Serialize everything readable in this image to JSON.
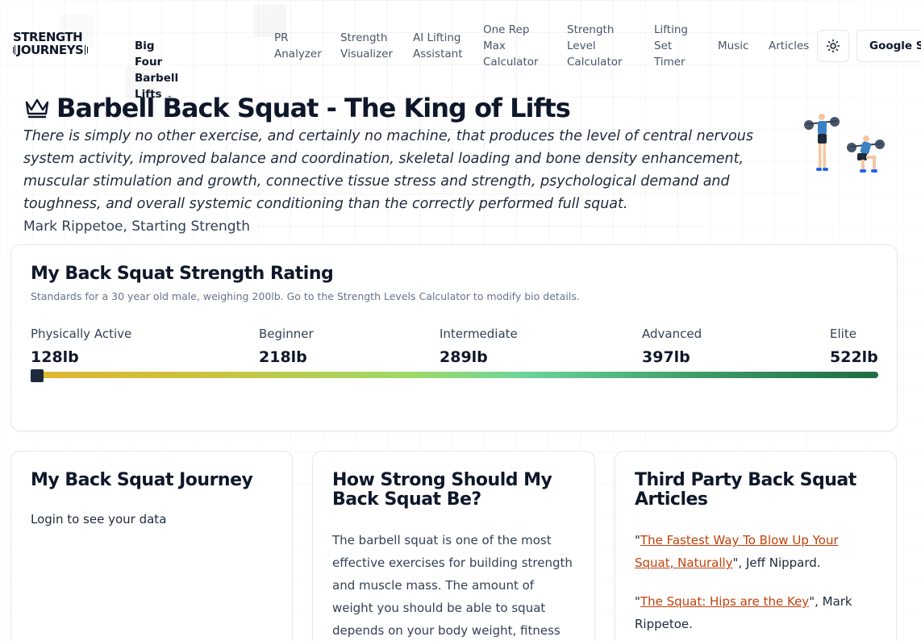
{
  "header": {
    "logo_line1": "STRENGTH",
    "logo_line2": "JOURNEYS",
    "nav": [
      {
        "label": "Big Four Barbell Lifts",
        "has_dropdown": true
      },
      {
        "label": "PR Analyzer"
      },
      {
        "label": "Strength Visualizer"
      },
      {
        "label": "AI Lifting Assistant"
      },
      {
        "label": "One Rep Max Calculator"
      },
      {
        "label": "Strength Level Calculator"
      },
      {
        "label": "Lifting Set Timer"
      },
      {
        "label": "Music"
      },
      {
        "label": "Articles"
      }
    ],
    "theme_icon": "sun-icon",
    "google_label": "Google Sign in"
  },
  "hero": {
    "title": "Barbell Back Squat - The King of Lifts",
    "quote": "There is simply no other exercise, and certainly no machine, that produces the level of central nervous system activity, improved balance and coordination, skeletal loading and bone density enhancement, muscular stimulation and growth, connective tissue stress and strength, psychological demand and toughness, and overall systemic conditioning than the correctly performed full squat.",
    "attribution": "Mark Rippetoe, Starting Strength"
  },
  "rating": {
    "title": "My Back Squat Strength Rating",
    "subtitle": "Standards for a 30 year old male, weighing 200lb. Go to the Strength Levels Calculator to modify bio details.",
    "levels": [
      {
        "name": "Physically Active",
        "value": "128lb"
      },
      {
        "name": "Beginner",
        "value": "218lb"
      },
      {
        "name": "Intermediate",
        "value": "289lb"
      },
      {
        "name": "Advanced",
        "value": "397lb"
      },
      {
        "name": "Elite",
        "value": "522lb"
      }
    ],
    "progress": 0
  },
  "journey": {
    "title": "My Back Squat Journey",
    "text": "Login to see your data"
  },
  "howstrong": {
    "title": "How Strong Should My Back Squat Be?",
    "text": "The barbell squat is one of the most effective exercises for building strength and muscle mass. The amount of weight you should be able to squat depends on your body weight, fitness level, and"
  },
  "articles": {
    "title": "Third Party Back Squat Articles",
    "items": [
      {
        "link": "The Fastest Way To Blow Up Your Squat, Naturally",
        "author": "\", Jeff Nippard."
      },
      {
        "link": "The Squat: Hips are the Key",
        "author": "\", Mark Rippetoe."
      }
    ],
    "open_quote": "\""
  },
  "colors": {
    "accent_link": "#c2410c",
    "bar_start": "#e0b630",
    "bar_end": "#1f6a44",
    "lifter_shirt": "#3b82c4",
    "lifter_shorts": "#1e293b"
  }
}
